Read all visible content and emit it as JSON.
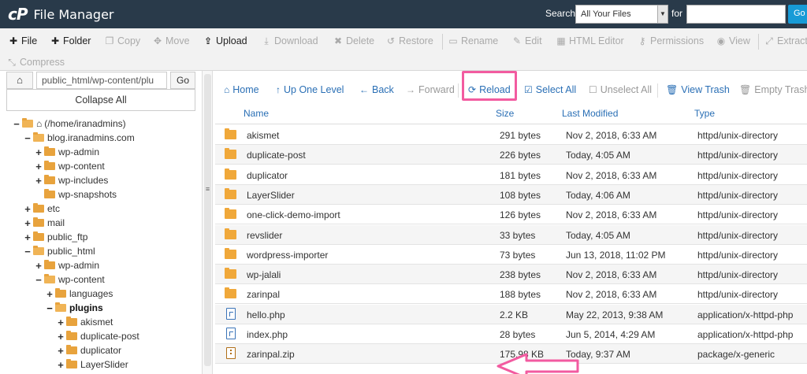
{
  "header": {
    "logo": "cP",
    "title": "File Manager",
    "search_label": "Search",
    "search_scope": "All Your Files",
    "for_label": "for",
    "search_value": "",
    "go_label": "Go"
  },
  "toolbar": {
    "items": [
      {
        "label": "File",
        "icon": "plus-icon",
        "state": "active"
      },
      {
        "label": "Folder",
        "icon": "plus-icon",
        "state": "active"
      },
      {
        "label": "Copy",
        "icon": "copy-icon",
        "state": "disabled"
      },
      {
        "label": "Move",
        "icon": "move-icon",
        "state": "disabled"
      },
      {
        "label": "Upload",
        "icon": "upload-icon",
        "state": "active"
      },
      {
        "label": "Download",
        "icon": "download-icon",
        "state": "disabled"
      },
      {
        "label": "Delete",
        "icon": "delete-icon",
        "state": "disabled"
      },
      {
        "label": "Restore",
        "icon": "restore-icon",
        "state": "disabled"
      },
      {
        "label": "Rename",
        "icon": "rename-icon",
        "state": "disabled"
      },
      {
        "label": "Edit",
        "icon": "edit-icon",
        "state": "disabled"
      },
      {
        "label": "HTML Editor",
        "icon": "html-editor-icon",
        "state": "disabled"
      },
      {
        "label": "Permissions",
        "icon": "key-icon",
        "state": "disabled"
      },
      {
        "label": "View",
        "icon": "eye-icon",
        "state": "disabled"
      },
      {
        "label": "Extract",
        "icon": "extract-icon",
        "state": "disabled"
      },
      {
        "label": "Compress",
        "icon": "compress-icon",
        "state": "disabled"
      }
    ]
  },
  "left": {
    "path_value": "public_html/wp-content/plu",
    "go_label": "Go",
    "collapse_label": "Collapse All",
    "tree": [
      {
        "label": "(/home/iranadmins)",
        "toggle": "−",
        "open": true,
        "home": true
      },
      {
        "label": "blog.iranadmins.com",
        "toggle": "−",
        "open": true
      },
      {
        "label": "wp-admin",
        "toggle": "+",
        "open": false
      },
      {
        "label": "wp-content",
        "toggle": "+",
        "open": false
      },
      {
        "label": "wp-includes",
        "toggle": "+",
        "open": false
      },
      {
        "label": "wp-snapshots",
        "toggle": "",
        "open": false
      },
      {
        "label": "etc",
        "toggle": "+",
        "open": false
      },
      {
        "label": "mail",
        "toggle": "+",
        "open": false
      },
      {
        "label": "public_ftp",
        "toggle": "+",
        "open": false
      },
      {
        "label": "public_html",
        "toggle": "−",
        "open": true
      },
      {
        "label": "wp-admin",
        "toggle": "+",
        "open": false
      },
      {
        "label": "wp-content",
        "toggle": "−",
        "open": true
      },
      {
        "label": "languages",
        "toggle": "+",
        "open": false
      },
      {
        "label": "plugins",
        "toggle": "−",
        "open": true,
        "bold": true
      },
      {
        "label": "akismet",
        "toggle": "+",
        "open": false
      },
      {
        "label": "duplicate-post",
        "toggle": "+",
        "open": false
      },
      {
        "label": "duplicator",
        "toggle": "+",
        "open": false
      },
      {
        "label": "LayerSlider",
        "toggle": "+",
        "open": false
      }
    ]
  },
  "nav": {
    "items": [
      {
        "label": "Home",
        "icon": "home-icon",
        "state": "active"
      },
      {
        "label": "Up One Level",
        "icon": "up-arrow-icon",
        "state": "active"
      },
      {
        "label": "Back",
        "icon": "back-arrow-icon",
        "state": "active"
      },
      {
        "label": "Forward",
        "icon": "forward-arrow-icon",
        "state": "disabled"
      },
      {
        "label": "Reload",
        "icon": "reload-icon",
        "state": "active"
      },
      {
        "label": "Select All",
        "icon": "checkbox-checked-icon",
        "state": "active"
      },
      {
        "label": "Unselect All",
        "icon": "checkbox-empty-icon",
        "state": "disabled"
      },
      {
        "label": "View Trash",
        "icon": "trash-icon",
        "state": "active"
      },
      {
        "label": "Empty Trash",
        "icon": "trash-icon",
        "state": "disabled"
      }
    ]
  },
  "table": {
    "columns": [
      "Name",
      "Size",
      "Last Modified",
      "Type"
    ],
    "rows": [
      {
        "kind": "folder",
        "name": "akismet",
        "size": "291 bytes",
        "modified": "Nov 2, 2018, 6:33 AM",
        "type": "httpd/unix-directory"
      },
      {
        "kind": "folder",
        "name": "duplicate-post",
        "size": "226 bytes",
        "modified": "Today, 4:05 AM",
        "type": "httpd/unix-directory"
      },
      {
        "kind": "folder",
        "name": "duplicator",
        "size": "181 bytes",
        "modified": "Nov 2, 2018, 6:33 AM",
        "type": "httpd/unix-directory"
      },
      {
        "kind": "folder",
        "name": "LayerSlider",
        "size": "108 bytes",
        "modified": "Today, 4:06 AM",
        "type": "httpd/unix-directory"
      },
      {
        "kind": "folder",
        "name": "one-click-demo-import",
        "size": "126 bytes",
        "modified": "Nov 2, 2018, 6:33 AM",
        "type": "httpd/unix-directory"
      },
      {
        "kind": "folder",
        "name": "revslider",
        "size": "33 bytes",
        "modified": "Today, 4:05 AM",
        "type": "httpd/unix-directory"
      },
      {
        "kind": "folder",
        "name": "wordpress-importer",
        "size": "73 bytes",
        "modified": "Jun 13, 2018, 11:02 PM",
        "type": "httpd/unix-directory"
      },
      {
        "kind": "folder",
        "name": "wp-jalali",
        "size": "238 bytes",
        "modified": "Nov 2, 2018, 6:33 AM",
        "type": "httpd/unix-directory"
      },
      {
        "kind": "folder",
        "name": "zarinpal",
        "size": "188 bytes",
        "modified": "Nov 2, 2018, 6:33 AM",
        "type": "httpd/unix-directory"
      },
      {
        "kind": "file",
        "name": "hello.php",
        "size": "2.2 KB",
        "modified": "May 22, 2013, 9:38 AM",
        "type": "application/x-httpd-php"
      },
      {
        "kind": "file",
        "name": "index.php",
        "size": "28 bytes",
        "modified": "Jun 5, 2014, 4:29 AM",
        "type": "application/x-httpd-php"
      },
      {
        "kind": "zip",
        "name": "zarinpal.zip",
        "size": "175.98 KB",
        "modified": "Today, 9:37 AM",
        "type": "package/x-generic"
      }
    ]
  },
  "colors": {
    "header_bg": "#293a4a",
    "link": "#2a6fb5",
    "highlight": "#f25ba0",
    "folder": "#f0a83a"
  }
}
